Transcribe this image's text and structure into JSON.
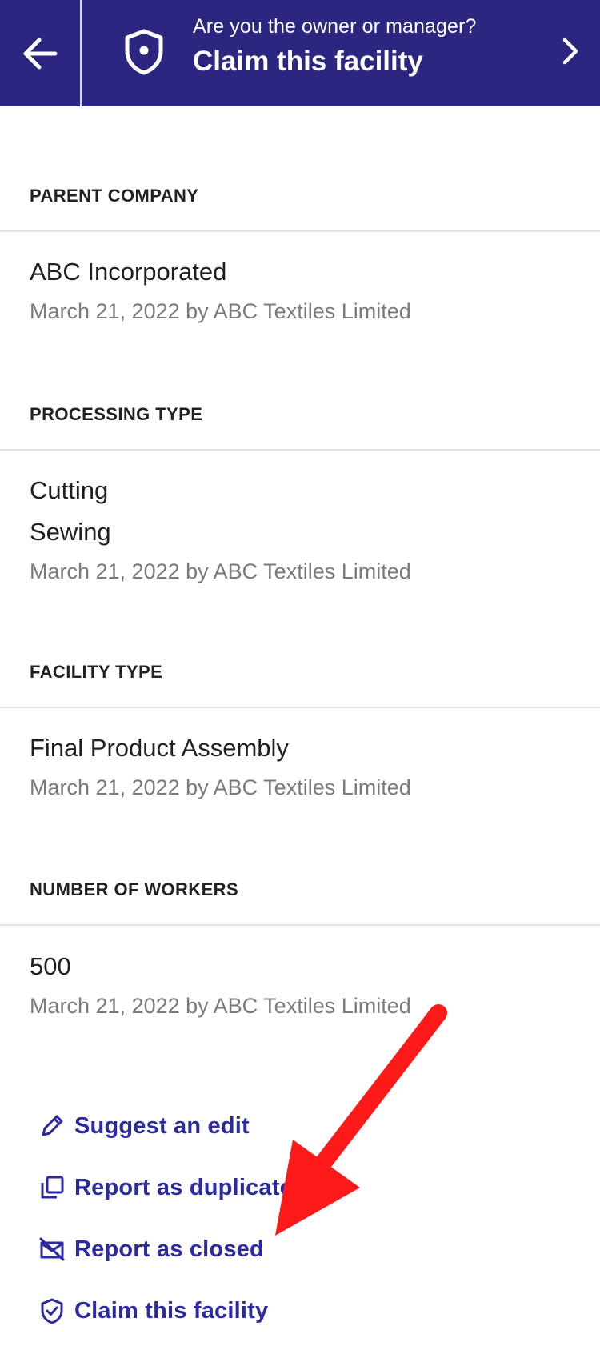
{
  "header": {
    "question": "Are you the owner or manager?",
    "title": "Claim this facility",
    "back_icon": "arrow-left-icon",
    "shield_icon": "shield-icon",
    "chevron_icon": "chevron-right-icon",
    "bg_color": "#2b2680"
  },
  "sections": [
    {
      "label": "PARENT COMPANY",
      "values": [
        "ABC Incorporated"
      ],
      "meta": "March 21, 2022 by ABC Textiles Limited"
    },
    {
      "label": "PROCESSING TYPE",
      "values": [
        "Cutting",
        "Sewing"
      ],
      "meta": "March 21, 2022 by ABC Textiles Limited"
    },
    {
      "label": "FACILITY TYPE",
      "values": [
        "Final Product Assembly"
      ],
      "meta": "March 21, 2022 by ABC Textiles Limited"
    },
    {
      "label": "NUMBER OF WORKERS",
      "values": [
        "500"
      ],
      "meta": "March 21, 2022 by ABC Textiles Limited"
    }
  ],
  "actions": [
    {
      "label": "Suggest an edit",
      "icon": "pencil-icon"
    },
    {
      "label": "Report as duplicate",
      "icon": "duplicate-icon"
    },
    {
      "label": "Report as closed",
      "icon": "closed-icon"
    },
    {
      "label": "Claim this facility",
      "icon": "shield-check-icon"
    }
  ],
  "colors": {
    "accent": "#2b2aa0",
    "annotation_arrow": "#ff1a1a"
  }
}
